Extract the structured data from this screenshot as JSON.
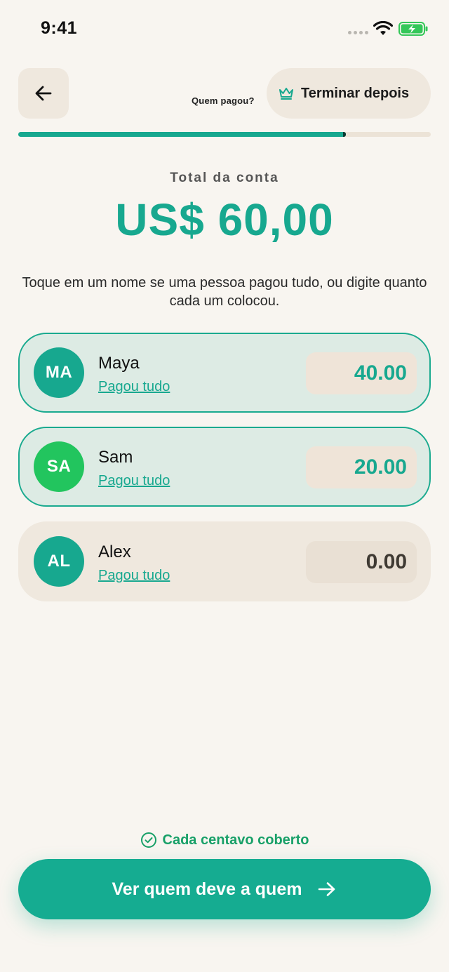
{
  "status_bar": {
    "time": "9:41"
  },
  "header": {
    "title": "Quem pagou?",
    "finish_later_label": "Terminar depois",
    "progress_fraction": 0.795
  },
  "total": {
    "label": "Total da conta",
    "amount": "US$ 60,00"
  },
  "instructions": "Toque em um nome se uma pessoa pagou tudo, ou digite quanto cada um colocou.",
  "people": [
    {
      "initials": "MA",
      "name": "Maya",
      "link": "Pagou tudo",
      "amount": "40.00",
      "state": "paid",
      "avatar_color": "#17a88f",
      "amount_color": "#17a88f"
    },
    {
      "initials": "SA",
      "name": "Sam",
      "link": "Pagou tudo",
      "amount": "20.00",
      "state": "paid",
      "avatar_color": "#22c55e",
      "amount_color": "#17a88f"
    },
    {
      "initials": "AL",
      "name": "Alex",
      "link": "Pagou tudo",
      "amount": "0.00",
      "state": "unpaid",
      "avatar_color": "#17a88f",
      "amount_color": "#3f3a33"
    }
  ],
  "footer": {
    "covered_label": "Cada centavo coberto",
    "cta_label": "Ver quem deve a quem"
  },
  "colors": {
    "accent": "#17a88f",
    "background": "#f8f5f0",
    "success": "#18a068"
  },
  "icons": [
    "back-arrow-icon",
    "crown-icon",
    "check-circle-icon",
    "arrow-right-icon",
    "wifi-icon",
    "battery-charging-icon"
  ]
}
